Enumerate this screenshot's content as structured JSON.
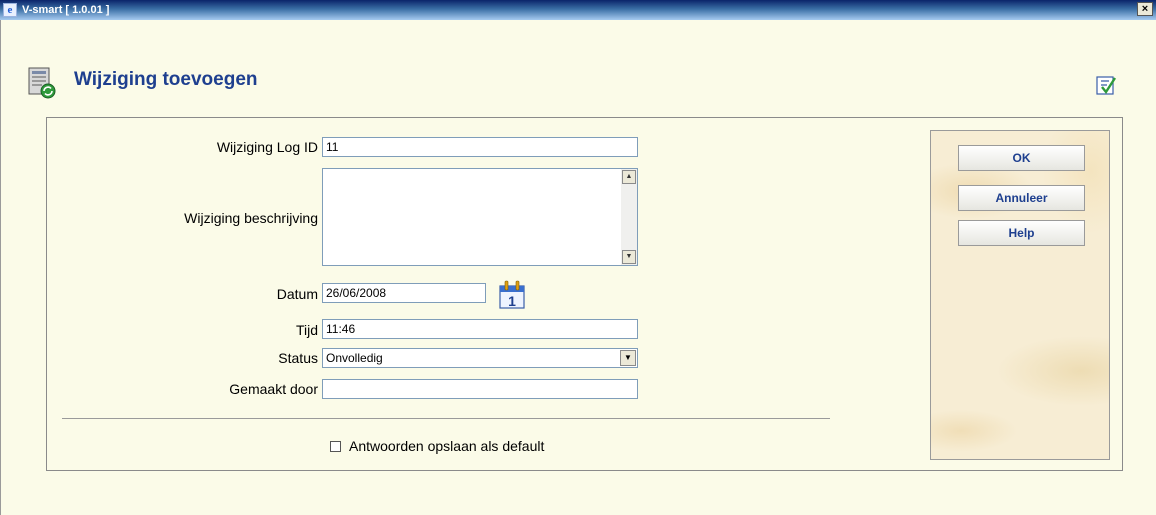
{
  "window": {
    "title": "V-smart [ 1.0.01 ]",
    "close_glyph": "×"
  },
  "header": {
    "title": "Wijziging toevoegen",
    "icon": "document-refresh-icon",
    "corner_icon": "checklist-icon"
  },
  "form": {
    "log_id": {
      "label": "Wijziging Log ID",
      "value": "11"
    },
    "description": {
      "label": "Wijziging beschrijving",
      "value": ""
    },
    "date": {
      "label": "Datum",
      "value": "26/06/2008",
      "calendar_day": "1"
    },
    "time": {
      "label": "Tijd",
      "value": "11:46"
    },
    "status": {
      "label": "Status",
      "value": "Onvolledig"
    },
    "made_by": {
      "label": "Gemaakt door",
      "value": ""
    },
    "save_default": {
      "label": "Antwoorden opslaan als default",
      "checked": false
    }
  },
  "buttons": {
    "ok": "OK",
    "cancel": "Annuleer",
    "help": "Help"
  },
  "colors": {
    "title": "#1e3f8f",
    "background": "#fbfbe8",
    "titlebar": "#0a246a"
  }
}
